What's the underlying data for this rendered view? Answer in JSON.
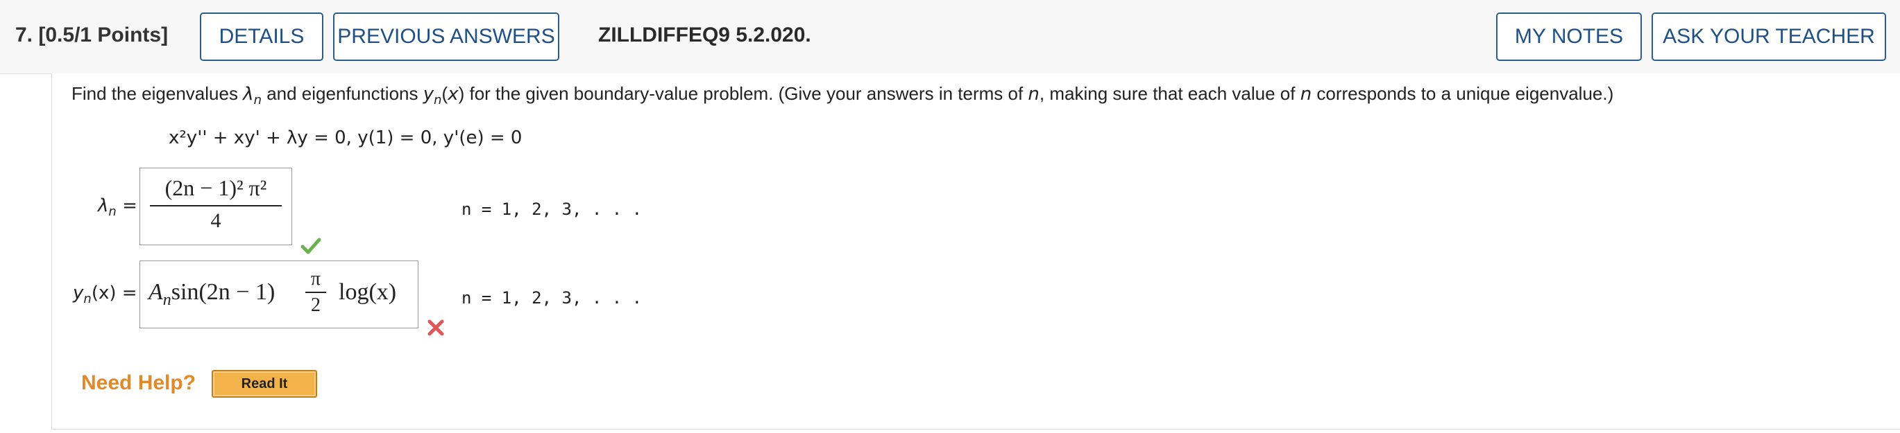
{
  "header": {
    "question_number": "7.",
    "points": "[0.5/1 Points]",
    "details_label": "DETAILS",
    "previous_answers_label": "PREVIOUS ANSWERS",
    "question_id": "ZILLDIFFEQ9 5.2.020.",
    "my_notes_label": "MY NOTES",
    "ask_teacher_label": "ASK YOUR TEACHER"
  },
  "question": {
    "prompt_part1": "Find the eigenvalues ",
    "prompt_part2": " and eigenfunctions ",
    "prompt_part3": " for the given boundary-value problem. (Give your answers in terms of ",
    "prompt_part4": ", making sure that each value of ",
    "prompt_part5": " corresponds to a unique eigenvalue.)",
    "equation": "x²y'' + xy' + λy = 0,  y(1) = 0,  y'(e) = 0"
  },
  "answers": {
    "eigenvalue": {
      "label_symbol": "λ",
      "label_sub": "n",
      "label_eq": " =",
      "numerator": "(2n − 1)² π²",
      "denominator": "4",
      "range": "n = 1, 2, 3, . . .",
      "status": "correct"
    },
    "eigenfunction": {
      "label": "y",
      "label_sub": "n",
      "label_rest": "(x) =",
      "coef": "A",
      "coef_sub": "n",
      "expr_part1": "sin(2n − 1)",
      "pi_num": "π",
      "pi_den": "2",
      "expr_part2": "log(x)",
      "range": "n = 1, 2, 3, . . .",
      "status": "incorrect"
    }
  },
  "help": {
    "need_help_label": "Need Help?",
    "read_it_label": "Read It"
  },
  "colors": {
    "accent_blue": "#1e4f85",
    "check_green": "#6ab04c",
    "cross_red": "#e05757",
    "help_orange": "#e08a2c"
  }
}
